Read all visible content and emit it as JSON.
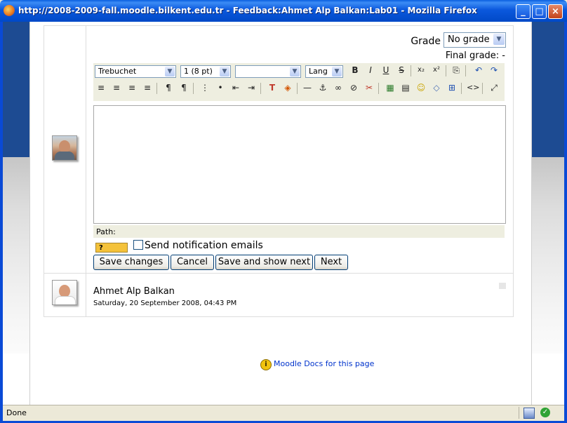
{
  "window": {
    "title": "http://2008-2009-fall.moodle.bilkent.edu.tr - Feedback:Ahmet Alp Balkan:Lab01 - Mozilla Firefox",
    "minimize": "_",
    "maximize": "□",
    "close": "×"
  },
  "grading": {
    "grade_label": "Grade",
    "grade_value": "No grade",
    "final_grade": "Final grade: -"
  },
  "editor": {
    "font_family": "Trebuchet",
    "font_size": "1 (8 pt)",
    "heading": "",
    "lang": "Lang",
    "toolbar_row1": [
      "B",
      "I",
      "U",
      "S",
      "x₂",
      "x²",
      "⎘",
      "↶",
      "↷"
    ],
    "toolbar_row2": [
      "≡",
      "≡",
      "≡",
      "≡",
      "¶",
      "¶",
      "⋮",
      "•",
      "⇤",
      "⇥",
      "T",
      "◈",
      "—",
      "⚓",
      "∞",
      "⊘",
      "✂",
      "▦",
      "▤",
      "☺",
      "◇",
      "⊞",
      "<>",
      "⤢"
    ],
    "content": "",
    "path_label": "Path:"
  },
  "help_icon_label": "?",
  "notification": {
    "label": "Send notification emails",
    "checked": false
  },
  "buttons": {
    "save": "Save changes",
    "cancel": "Cancel",
    "save_next": "Save and show next",
    "next": "Next"
  },
  "submission": {
    "student_name": "Ahmet Alp Balkan",
    "date": "Saturday, 20 September 2008, 04:43 PM"
  },
  "footer": {
    "docs_link": "Moodle Docs for this page"
  },
  "statusbar": {
    "text": "Done"
  }
}
